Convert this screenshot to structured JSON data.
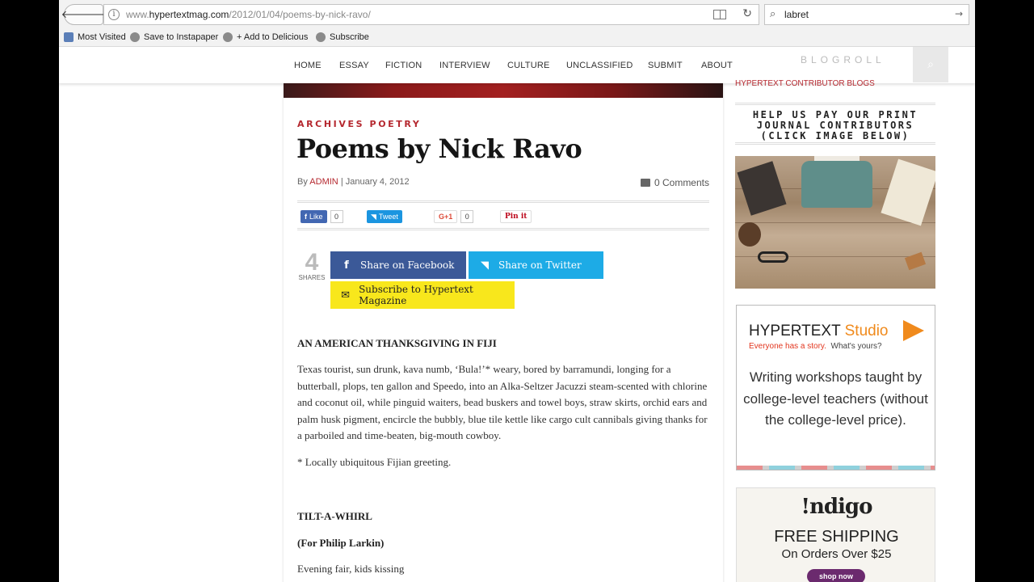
{
  "browser": {
    "url_prefix": "www.",
    "url_host": "hypertextmag.com",
    "url_path": "/2012/01/04/poems-by-nick-ravo/",
    "search_value": "labret",
    "bookmarks": [
      "Most Visited",
      "Save to Instapaper",
      "+ Add to Delicious",
      "Subscribe"
    ]
  },
  "nav": {
    "items": [
      "HOME",
      "ESSAY",
      "FICTION",
      "INTERVIEW",
      "CULTURE",
      "UNCLASSIFIED",
      "SUBMIT",
      "ABOUT"
    ],
    "blogroll": "BLOGROLL"
  },
  "article": {
    "categories": "ARCHIVES POETRY",
    "title": "Poems by Nick Ravo",
    "by": "By",
    "author": "ADMIN",
    "separator": "|",
    "date": "January 4, 2012",
    "comments": "0 Comments",
    "social": {
      "like_label": "Like",
      "like_count": "0",
      "tweet_label": "Tweet",
      "gplus_label": "G+1",
      "gplus_count": "0",
      "pin_label": "Pin it"
    },
    "share_count": "4",
    "share_label": "SHARES",
    "share_facebook": "Share on Facebook",
    "share_twitter": "Share on Twitter",
    "subscribe": "Subscribe to Hypertext Magazine",
    "poem1_title": "AN AMERICAN THANKSGIVING IN FIJI",
    "poem1_body": "Texas tourist, sun drunk, kava numb, ‘Bula!’* weary, bored by barramundi, longing for a butterball, plops, ten gallon and Speedo, into an Alka-Seltzer Jacuzzi steam-scented with chlorine and coconut oil, while pinguid waiters, bead buskers and towel boys, straw skirts, orchid ears and palm husk pigment, encircle the bubbly, blue tile kettle like cargo cult cannibals giving thanks for a parboiled and time-beaten, big-mouth cowboy.",
    "poem1_note": "* Locally ubiquitous Fijian greeting.",
    "poem2_title": "TILT-A-WHIRL",
    "poem2_dedication": "(For Philip Larkin)",
    "poem2_line1": "Evening fair, kids kissing"
  },
  "sidebar": {
    "contributor_link": "HYPERTEXT CONTRIBUTOR BLOGS",
    "help_text": "HELP US PAY OUR PRINT JOURNAL CONTRIBUTORS (CLICK IMAGE BELOW)",
    "studio_brand": "HYPERTEXT",
    "studio_brand_accent": "Studio",
    "studio_tag_accent": "Everyone has a story.",
    "studio_tag": "What's yours?",
    "studio_body": "Writing workshops taught by college-level teachers (without the college-level price).",
    "indigo_logo": "!ndigo",
    "indigo_shipping": "FREE SHIPPING",
    "indigo_orders": "On Orders Over $25",
    "indigo_button": "shop now"
  },
  "colors": {
    "accent_red": "#b5282f",
    "facebook": "#3b5998",
    "twitter": "#1dabe6",
    "subscribe": "#f8e71c",
    "studio_orange": "#f08a1c"
  }
}
